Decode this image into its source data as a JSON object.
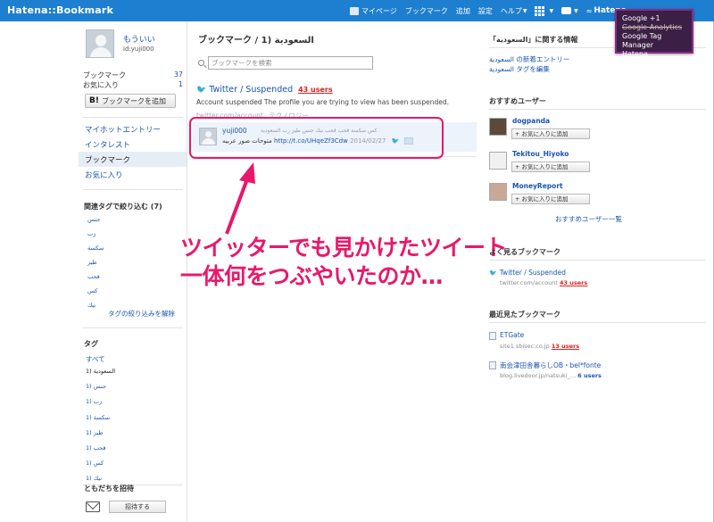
{
  "topbar": {
    "logo": "Hatena::Bookmark",
    "nav": [
      "マイページ",
      "ブックマーク",
      "追加",
      "設定",
      "ヘルプ"
    ],
    "brand": "Hatena"
  },
  "dropdown": {
    "items": [
      "Google +1",
      "Google Analytics",
      "Google Tag Manager",
      "Hatena"
    ]
  },
  "user": {
    "name": "もういい",
    "id": "id:yuji000",
    "bookmark_label": "ブックマーク",
    "bookmark_count": "37",
    "favorites_label": "お気に入り",
    "favorites_count": "1",
    "add_button": "ブックマークを追加",
    "add_button_prefix": "B!"
  },
  "left_nav": [
    "マイホットエントリー",
    "インタレスト",
    "ブックマーク",
    "お気に入り"
  ],
  "related_tags": {
    "heading": "関連タグで絞り込む (7)",
    "tags": [
      "جنس",
      "زب",
      "سكسة",
      "طيز",
      "قحب",
      "كس",
      "نيك"
    ],
    "more": "タグの絞り込みを解除"
  },
  "tags": {
    "heading": "タグ",
    "all": "すべて",
    "list": [
      "1) السعودية",
      "1) جنس",
      "1) زب",
      "1) سكسة",
      "1) طيز",
      "1) قحب",
      "1) كس",
      "1) نيك"
    ]
  },
  "invite": {
    "heading": "ともだちを招待",
    "button": "招待する"
  },
  "main": {
    "title": "ブックマーク / 1) السعودية",
    "search_placeholder": "ブックマークを検索",
    "entry": {
      "title": "Twitter / Suspended",
      "users": "43 users",
      "description": "Account suspended The profile you are trying to view has been suspended.",
      "domain": "twitter.com/account",
      "category": "テクノロジー"
    },
    "comment": {
      "user": "yuji000",
      "tags": "كس سكسة قحب قحب نيك جنس طيز زب السعودية",
      "text": "متوحات صور عربيه",
      "link": "http://t.co/UHqeZf3Cdw",
      "date": "2014/02/27"
    }
  },
  "annotation": {
    "line1": "ツイッターでも見かけたツイート",
    "line2": "一体何をつぶやいたのか…"
  },
  "right": {
    "related_heading": "「السعودية」に関する情報",
    "related_links": [
      "السعودية の新着エントリー",
      "السعودية タグを編集"
    ],
    "recommended_heading": "おすすめユーザー",
    "users": [
      {
        "name": "dogpanda",
        "button": "お気に入りに追加"
      },
      {
        "name": "Tekitou_Hiyoko",
        "button": "お気に入りに追加"
      },
      {
        "name": "MoneyReport",
        "button": "お気に入りに追加"
      }
    ],
    "recommended_more": "おすすめユーザー一覧",
    "frequent_heading": "よく見るブックマーク",
    "frequent": {
      "title": "Twitter / Suspended",
      "domain": "twitter.com/account",
      "users": "43 users"
    },
    "recent_heading": "最近見たブックマーク",
    "recent": [
      {
        "title": "ETGate",
        "domain": "site1.sbisec.co.jp",
        "users": "13 users"
      },
      {
        "title": "南会津田舎暮らしOB・bel*fonte",
        "domain": "blog.livedoor.jp/natsuki_...",
        "users": "6 users"
      }
    ]
  },
  "colors": {
    "topbar": "#1e7fd0",
    "accent": "#e8186b",
    "link": "#1a55b0",
    "users": "#e02020"
  }
}
